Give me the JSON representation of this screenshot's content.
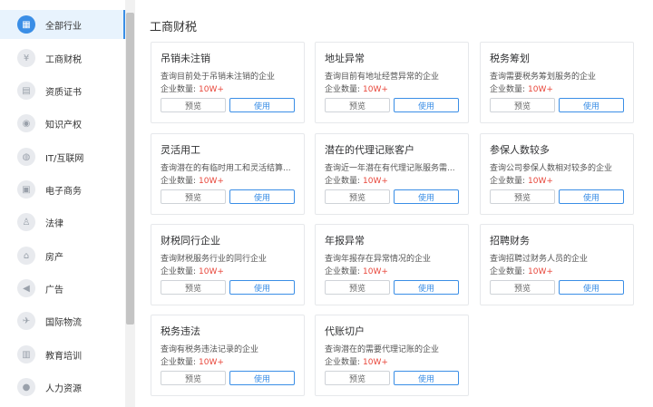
{
  "sidebar": {
    "items": [
      {
        "label": "全部行业",
        "icon": "grid-icon",
        "glyph": "▦"
      },
      {
        "label": "工商财税",
        "icon": "yen-icon",
        "glyph": "¥"
      },
      {
        "label": "资质证书",
        "icon": "certificate-icon",
        "glyph": "▤"
      },
      {
        "label": "知识产权",
        "icon": "lightbulb-icon",
        "glyph": "◉"
      },
      {
        "label": "IT/互联网",
        "icon": "globe-icon",
        "glyph": "◍"
      },
      {
        "label": "电子商务",
        "icon": "cart-icon",
        "glyph": "▣"
      },
      {
        "label": "法律",
        "icon": "gavel-icon",
        "glyph": "♙"
      },
      {
        "label": "房产",
        "icon": "house-icon",
        "glyph": "⌂"
      },
      {
        "label": "广告",
        "icon": "megaphone-icon",
        "glyph": "◀"
      },
      {
        "label": "国际物流",
        "icon": "plane-icon",
        "glyph": "✈"
      },
      {
        "label": "教育培训",
        "icon": "book-icon",
        "glyph": "▥"
      },
      {
        "label": "人力资源",
        "icon": "person-icon",
        "glyph": "●"
      }
    ]
  },
  "main": {
    "title": "工商财税",
    "count_label": "企业数量:",
    "preview_label": "预览",
    "use_label": "使用",
    "cards": [
      {
        "title": "吊销未注销",
        "desc": "查询目前处于吊销未注销的企业",
        "count": "10W+"
      },
      {
        "title": "地址异常",
        "desc": "查询目前有地址经营异常的企业",
        "count": "10W+"
      },
      {
        "title": "税务筹划",
        "desc": "查询需要税务筹划服务的企业",
        "count": "10W+"
      },
      {
        "title": "灵活用工",
        "desc": "查询潜在的有临时用工和灵活结算...",
        "count": "10W+"
      },
      {
        "title": "潜在的代理记账客户",
        "desc": "查询近一年潜在有代理记账服务需...",
        "count": "10W+"
      },
      {
        "title": "参保人数较多",
        "desc": "查询公司参保人数相对较多的企业",
        "count": "10W+"
      },
      {
        "title": "财税同行企业",
        "desc": "查询财税服务行业的同行企业",
        "count": "10W+"
      },
      {
        "title": "年报异常",
        "desc": "查询年报存在异常情况的企业",
        "count": "10W+"
      },
      {
        "title": "招聘财务",
        "desc": "查询招聘过财务人员的企业",
        "count": "10W+"
      },
      {
        "title": "税务违法",
        "desc": "查询有税务违法记录的企业",
        "count": "10W+"
      },
      {
        "title": "代账切户",
        "desc": "查询潜在的需要代理记账的企业",
        "count": "10W+"
      }
    ]
  },
  "colors": {
    "accent": "#3a8ee6",
    "count": "#e8463a",
    "active_bg": "#e8f3fd"
  }
}
